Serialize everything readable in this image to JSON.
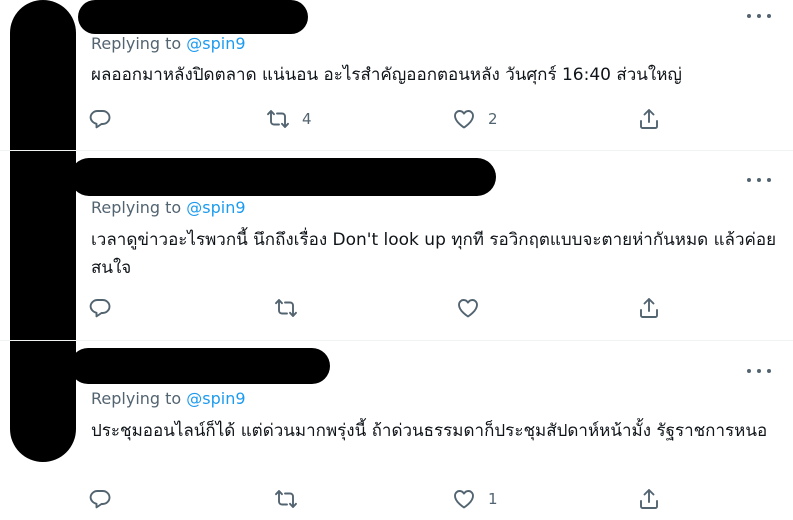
{
  "colors": {
    "accent": "#1d9bf0",
    "muted": "#536471",
    "text": "#0f1419",
    "divider": "#eff3f4"
  },
  "tweets": [
    {
      "replying_prefix": "Replying to",
      "replying_handle": "@spin9",
      "text": "ผลออกมาหลังปิดตลาด แน่นอน อะไรสำคัญออกตอนหลัง วันศุกร์ 16:40 ส่วนใหญ่",
      "reply_count": "",
      "retweet_count": "4",
      "like_count": "2"
    },
    {
      "replying_prefix": "Replying to",
      "replying_handle": "@spin9",
      "text": "เวลาดูข่าวอะไรพวกนี้ นึกถึงเรื่อง Don't look up ทุกที รอวิกฤตแบบจะตายห่ากันหมด แล้วค่อยสนใจ",
      "reply_count": "",
      "retweet_count": "",
      "like_count": ""
    },
    {
      "replying_prefix": "Replying to",
      "replying_handle": "@spin9",
      "text": "ประชุมออนไลน์ก็ได้ แต่ด่วนมากพรุ่งนี้ ถ้าด่วนธรรมดาก็ประชุมสัปดาห์หน้ามั้ง รัฐราชการหนอ",
      "reply_count": "",
      "retweet_count": "",
      "like_count": "1"
    }
  ],
  "icons": {
    "reply": "reply-icon",
    "retweet": "retweet-icon",
    "like": "heart-icon",
    "share": "share-icon",
    "more": "more-icon"
  }
}
